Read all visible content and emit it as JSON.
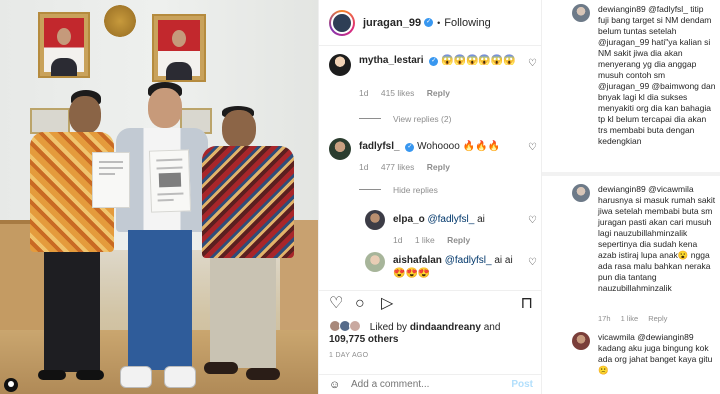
{
  "post": {
    "username": "juragan_99",
    "follow_status": "Following",
    "separator": "•"
  },
  "comments": [
    {
      "username": "mytha_lestari",
      "text": "😱😱😱😱😱😱",
      "time": "1d",
      "likes": "415 likes",
      "reply_label": "Reply",
      "thread_toggle": "View replies (2)"
    },
    {
      "username": "fadlyfsl_",
      "text": "Wohoooo 🔥🔥🔥",
      "time": "1d",
      "likes": "477 likes",
      "reply_label": "Reply",
      "thread_toggle": "Hide replies",
      "replies": [
        {
          "username": "elpa_o",
          "mention": "@fadlyfsl_",
          "text": "ai",
          "time": "1d",
          "likes": "1 like",
          "reply_label": "Reply"
        },
        {
          "username": "aishafalan",
          "mention": "@fadlyfsl_",
          "text": "ai ai",
          "second_line": "😍😍😍"
        }
      ]
    }
  ],
  "actions": {
    "like": "♡",
    "comment": "○",
    "share": "▷",
    "save": "⊓"
  },
  "likes": {
    "prefix": "Liked by",
    "user": "dindaandreany",
    "and": "and",
    "count": "109,775 others"
  },
  "post_date": "1 DAY AGO",
  "add_comment": {
    "placeholder": "Add a comment...",
    "post_label": "Post"
  },
  "thread": [
    {
      "username": "dewiangin89",
      "text": "@fadlyfsl_ titip fuji bang target si NM dendam belum tuntas setelah @juragan_99 hati\"ya kalian si NM sakit jiwa dia akan menyerang yg dia anggap musuh contoh sm @juragan_99 @baimwong dan bnyak lagi kl dia sukses menyakiti org dia kan bahagia tp kl belum tercapai dia akan trs membabi buta dengan kedengkian"
    },
    {
      "username": "dewiangin89",
      "text": "@vicawmila harusnya si masuk rumah sakit jiwa setelah membabi buta sm juragan pasti akan cari musuh lagi nauzubillahminzalik sepertinya dia sudah kena azab istiraj lupa anak😮 ngga ada rasa malu bahkan neraka pun dia tantang nauzubillahminzalik",
      "time": "17h",
      "likes": "1 like",
      "reply_label": "Reply"
    },
    {
      "username": "vicawmila",
      "text": "@dewiangin89 kadang aku juga bingung kok ada org jahat banget kaya gitu 🙁"
    }
  ],
  "colors": {
    "verified": "#3897f0",
    "meta_text": "#8e8e8e",
    "post_disabled": "#b2dffc"
  }
}
